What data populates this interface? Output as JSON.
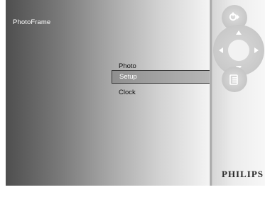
{
  "screen": {
    "title": "PhotoFrame"
  },
  "menu": {
    "items": [
      {
        "label": "Photo",
        "selected": false
      },
      {
        "label": "Setup",
        "selected": true
      },
      {
        "label": "Clock",
        "selected": false
      }
    ]
  },
  "controls": {
    "top_button_icon": "power-play-icon",
    "dpad_icons": [
      "arrow-up-icon",
      "arrow-down-icon",
      "arrow-left-icon",
      "arrow-right-icon"
    ],
    "menu_button_icon": "menu-icon"
  },
  "brand": {
    "name": "PHILIPS"
  },
  "colors": {
    "selection_border": "#3a3a3a",
    "menu_text": "#111111",
    "title_text": "#ffffff"
  }
}
